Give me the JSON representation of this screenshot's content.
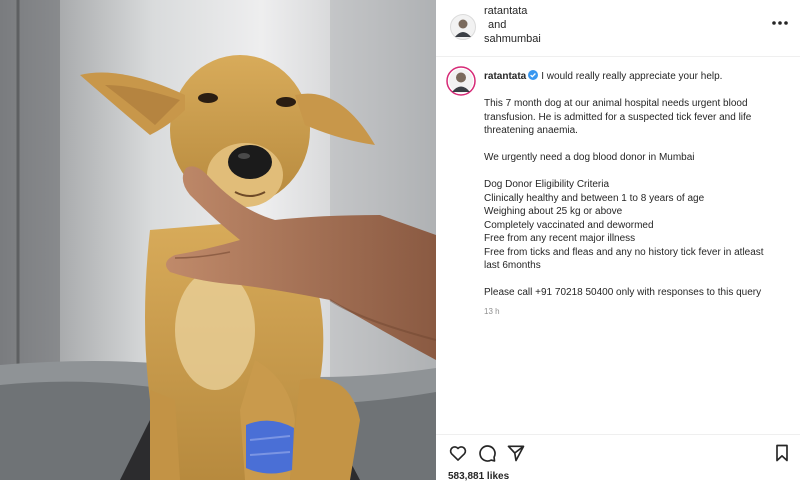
{
  "header": {
    "username": "ratantata",
    "conjunction": "and",
    "collab_username": "sahmumbai",
    "more_icon": "more-horizontal-icon"
  },
  "post": {
    "username": "ratantata",
    "verified": true,
    "intro": "I would really really appreciate your help.",
    "paragraph_1": [
      "This 7 month dog at our animal hospital needs urgent blood",
      "transfusion. He is admitted for a suspected tick fever and life",
      "threatening anaemia."
    ],
    "paragraph_2": "We urgently need a dog blood donor in Mumbai",
    "criteria": [
      "Dog Donor Eligibility Criteria",
      "Clinically healthy and between 1 to 8 years of age",
      "Weighing about 25 kg or above",
      "Completely vaccinated and dewormed",
      "Free from any recent major illness",
      "Free from ticks and fleas and any no history tick fever in atleast",
      "last 6months"
    ],
    "call": "Please call +91 70218 50400 only with responses to this query",
    "time": "13 h"
  },
  "actions": {
    "icons": [
      "heart-icon",
      "comment-icon",
      "share-icon",
      "bookmark-icon"
    ]
  },
  "likes": "583,881 likes",
  "colors": {
    "text": "#262626",
    "muted": "#8e8e8e",
    "verified_badge": "#3897f0",
    "dog_fur": "#c9a052",
    "bandage": "#4a6fd6"
  }
}
